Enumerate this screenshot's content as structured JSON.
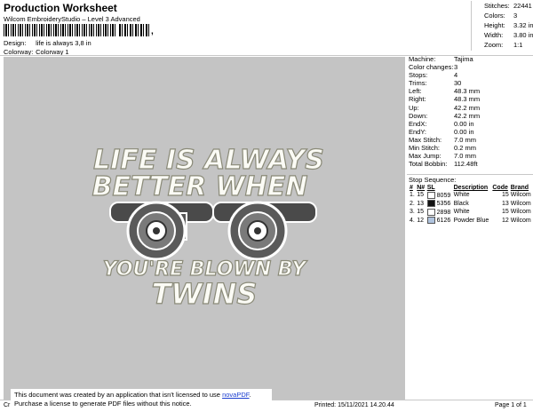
{
  "header": {
    "title": "Production Worksheet",
    "subtitle": "Wilcom EmbroideryStudio – Level 3 Advanced",
    "design_label": "Design:",
    "design_value": "life is always 3,8 in",
    "colorway_label": "Colorway:",
    "colorway_value": "Colorway 1"
  },
  "stats": [
    {
      "label": "Stitches:",
      "value": "22441"
    },
    {
      "label": "Colors:",
      "value": "3"
    },
    {
      "label": "Height:",
      "value": "3.32 in"
    },
    {
      "label": "Width:",
      "value": "3.80 in"
    },
    {
      "label": "Zoom:",
      "value": "1:1"
    }
  ],
  "params": [
    {
      "label": "Machine:",
      "value": "Tajima"
    },
    {
      "label": "Color changes:",
      "value": "3"
    },
    {
      "label": "Stops:",
      "value": "4"
    },
    {
      "label": "Trims:",
      "value": "30"
    },
    {
      "label": "Left:",
      "value": "48.3 mm"
    },
    {
      "label": "Right:",
      "value": "48.3 mm"
    },
    {
      "label": "Up:",
      "value": "42.2 mm"
    },
    {
      "label": "Down:",
      "value": "42.2 mm"
    },
    {
      "label": "EndX:",
      "value": "0.00 in"
    },
    {
      "label": "EndY:",
      "value": "0.00 in"
    },
    {
      "label": "Max Stitch:",
      "value": "7.0 mm"
    },
    {
      "label": "Min Stitch:",
      "value": "0.2 mm"
    },
    {
      "label": "Max Jump:",
      "value": "7.0 mm"
    },
    {
      "label": "Total Bobbin:",
      "value": "112.48ft"
    }
  ],
  "stop_sequence": {
    "title": "Stop Sequence:",
    "headers": [
      "#",
      "N#",
      "SL",
      "Description",
      "Code",
      "Brand"
    ],
    "rows": [
      {
        "num": "1.",
        "n": "15",
        "swatch": "#ffffff",
        "sl": "8059",
        "desc": "White",
        "code": "15",
        "brand": "Wilcom"
      },
      {
        "num": "2.",
        "n": "13",
        "swatch": "#111111",
        "sl": "5356",
        "desc": "Black",
        "code": "13",
        "brand": "Wilcom"
      },
      {
        "num": "3.",
        "n": "15",
        "swatch": "#ffffff",
        "sl": "2898",
        "desc": "White",
        "code": "15",
        "brand": "Wilcom"
      },
      {
        "num": "4.",
        "n": "12",
        "swatch": "#b0c4de",
        "sl": "6126",
        "desc": "Powder Blue",
        "code": "12",
        "brand": "Wilcom"
      }
    ]
  },
  "artwork": {
    "line1": "LIFE IS ALWAYS",
    "line2": "BETTER WHEN",
    "line3": "YOU'RE BLOWN BY",
    "line4": "TWINS"
  },
  "notice": {
    "text1": "This document was created by an application that isn't licensed to use ",
    "link": "novaPDF",
    "text1_end": ".",
    "text2": "Purchase a license to generate PDF files without this notice."
  },
  "footer": {
    "left": "Cr",
    "printed": "Printed: 15/11/2021 14.20.44",
    "page": "Page 1 of 1"
  }
}
